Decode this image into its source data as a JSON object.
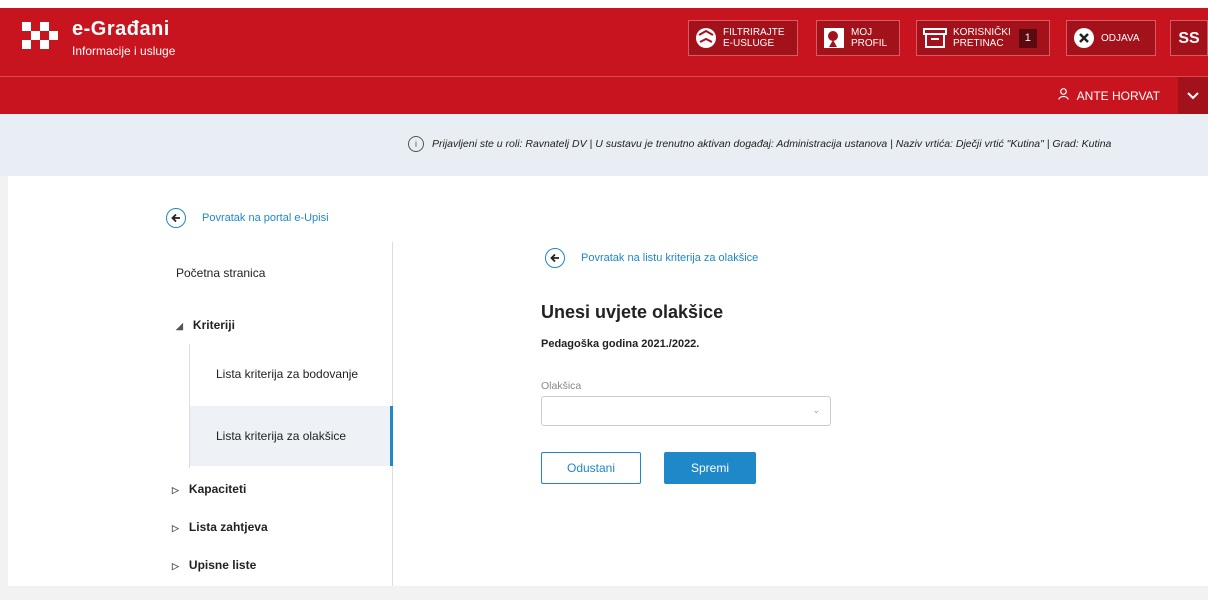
{
  "header": {
    "brand_title": "e-Građani",
    "brand_subtitle": "Informacije i usluge",
    "buttons": [
      {
        "line1": "FILTRIRAJTE",
        "line2": "E-USLUGE",
        "icon": "filter-ball-icon"
      },
      {
        "line1": "MOJ",
        "line2": "PROFIL",
        "icon": "profile-icon"
      },
      {
        "line1": "KORISNIČKI",
        "line2": "PRETINAC",
        "icon": "inbox-icon",
        "badge": "1"
      },
      {
        "line1": "ODJAVA",
        "line2": "",
        "icon": "close-circle-icon"
      }
    ],
    "accessibility_label": "ß"
  },
  "user": {
    "name": "ANTE HORVAT"
  },
  "info": {
    "text": "Prijavljeni ste u roli: Ravnatelj DV | U sustavu je trenutno aktivan događaj: Administracija ustanova | Naziv vrtića: Dječji vrtić \"Kutina\" | Grad: Kutina"
  },
  "sidebar": {
    "back_link": "Povratak na portal e-Upisi",
    "home": "Početna stranica",
    "criteria": "Kriteriji",
    "sub_items": [
      "Lista kriterija za bodovanje",
      "Lista kriterija za olakšice"
    ],
    "capacities": "Kapaciteti",
    "requests": "Lista zahtjeva",
    "enrollment": "Upisne liste"
  },
  "main": {
    "back_link": "Povratak na listu kriterija za olakšice",
    "title": "Unesi uvjete olakšice",
    "subtitle": "Pedagoška godina 2021./2022.",
    "field_label": "Olakšica",
    "field_value": "",
    "cancel_label": "Odustani",
    "save_label": "Spremi"
  },
  "colors": {
    "brand_red": "#c8141e",
    "accent_blue": "#1e88c8"
  }
}
